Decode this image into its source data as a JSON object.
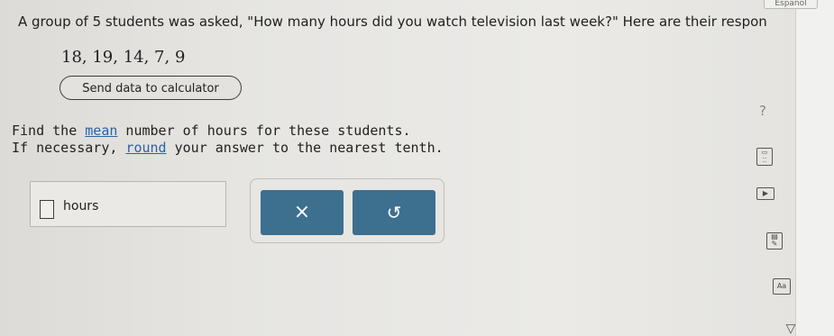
{
  "header": {
    "language_button": "Español"
  },
  "question": {
    "prompt": "A group of 5 students was asked, \"How many hours did you watch television last week?\" Here are their respon",
    "values_text": "18, 19, 14, 7, 9",
    "send_button": "Send data to calculator"
  },
  "instructions": {
    "line1_pre": "Find the ",
    "line1_link": "mean",
    "line1_post": " number of hours for these students.",
    "line2_pre": "If necessary, ",
    "line2_link": "round",
    "line2_post": " your answer to the nearest tenth."
  },
  "answer": {
    "value": "",
    "unit": "hours"
  },
  "actions": {
    "clear_label": "×",
    "undo_label": "↺"
  },
  "sidebar": {
    "help_label": "?",
    "aa_label": "Aa"
  },
  "icons": [
    "help-icon",
    "calculator-icon",
    "play-icon",
    "notes-icon",
    "text-size-icon",
    "chevron-down-icon",
    "clear-icon",
    "undo-icon"
  ],
  "colors": {
    "button_bg": "#3d6f8f",
    "link": "#2b62a8",
    "background": "#e6e5e2"
  }
}
